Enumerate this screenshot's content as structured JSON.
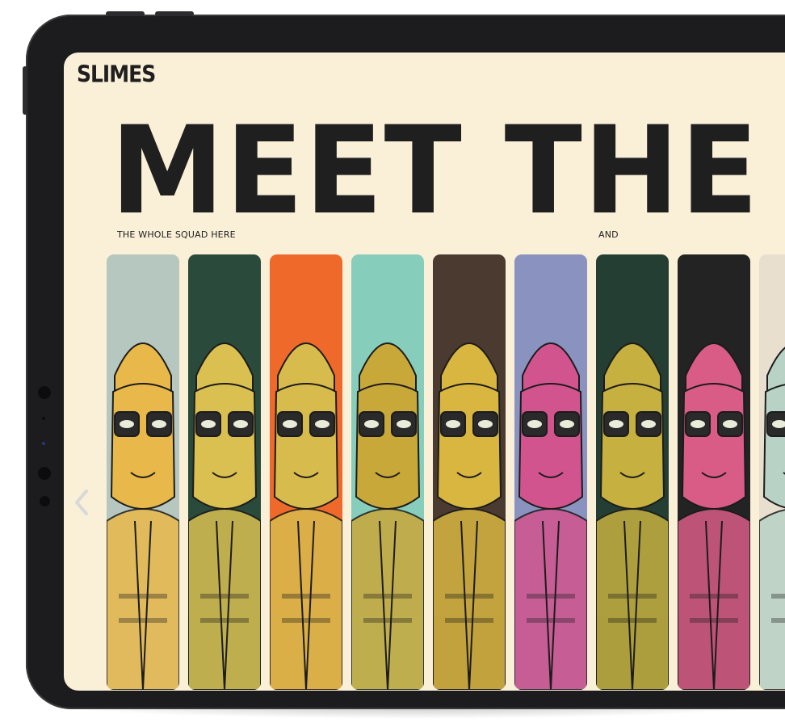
{
  "brand": {
    "logo": "SLIMES"
  },
  "hero": {
    "headline": "MEET THE S",
    "subtitle_left": "THE WHOLE SQUAD HERE",
    "subtitle_right": "AND"
  },
  "characters": [
    {
      "bg": "#b6c7c0",
      "accent": "#e8b84a",
      "label": "slime-1"
    },
    {
      "bg": "#2a4a3c",
      "accent": "#d9c050",
      "label": "slime-2"
    },
    {
      "bg": "#ef6a2a",
      "accent": "#d8bb4d",
      "label": "slime-3"
    },
    {
      "bg": "#86cdbb",
      "accent": "#c9a83a",
      "label": "slime-4"
    },
    {
      "bg": "#4a3a30",
      "accent": "#d8b640",
      "label": "slime-5"
    },
    {
      "bg": "#8a93c0",
      "accent": "#d2548e",
      "label": "slime-6"
    },
    {
      "bg": "#253e33",
      "accent": "#c6b040",
      "label": "slime-7"
    },
    {
      "bg": "#232323",
      "accent": "#d95c86",
      "label": "slime-8"
    },
    {
      "bg": "#e9dfcf",
      "accent": "#b8d3c5",
      "label": "slime-9"
    }
  ],
  "colors": {
    "screen_bg": "#faefd7",
    "text": "#1f1f1f"
  },
  "icons": {
    "prev": "chevron-left-icon"
  }
}
